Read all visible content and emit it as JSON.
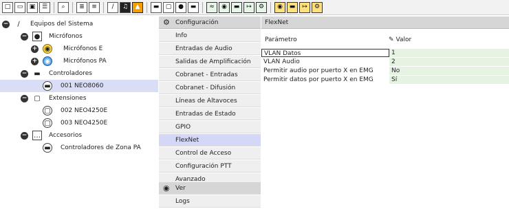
{
  "toolbar": {
    "buttons": [
      {
        "icon": "new-document-icon",
        "glyph": "□"
      },
      {
        "icon": "new-window-icon",
        "glyph": "▭"
      },
      {
        "icon": "save-icon",
        "glyph": "▣"
      },
      {
        "icon": "print-icon",
        "glyph": "☰"
      },
      {
        "icon": "search-icon",
        "glyph": "⌕"
      },
      {
        "icon": "properties-icon",
        "glyph": "≣"
      },
      {
        "icon": "list-icon",
        "glyph": "≡"
      },
      {
        "icon": "pencil-icon",
        "glyph": "∕"
      },
      {
        "icon": "music-icon",
        "glyph": "♫"
      },
      {
        "icon": "flag-icon",
        "glyph": "▲"
      },
      {
        "icon": "monitor-icon",
        "glyph": "▬"
      },
      {
        "icon": "extension-icon",
        "glyph": "▢"
      },
      {
        "icon": "microphone-icon",
        "glyph": "●"
      },
      {
        "icon": "controller-icon",
        "glyph": "▬"
      },
      {
        "icon": "wave-icon",
        "glyph": "≈"
      },
      {
        "icon": "mic-blue-icon",
        "glyph": "◉"
      },
      {
        "icon": "chat-icon",
        "glyph": "▬"
      },
      {
        "icon": "export-icon",
        "glyph": "↦"
      },
      {
        "icon": "settings-icon",
        "glyph": "⚙"
      },
      {
        "icon": "yellow-mic-icon",
        "glyph": "◉"
      },
      {
        "icon": "speaker-icon",
        "glyph": "▬"
      },
      {
        "icon": "forward-icon",
        "glyph": "↦"
      },
      {
        "icon": "gear-small-icon",
        "glyph": "⚙"
      }
    ]
  },
  "tree": [
    {
      "label": "Equipos del Sistema",
      "icon": "pencil-icon",
      "glyph": "∕",
      "expander": "−"
    },
    {
      "label": "Micrófonos",
      "icon": "microphone-icon",
      "glyph": "●",
      "expander": "−"
    },
    {
      "label": "Micrófonos E",
      "icon": "yellow-mic-icon",
      "glyph": "◉",
      "expander": "+"
    },
    {
      "label": "Micrófonos PA",
      "icon": "blue-mic-icon",
      "glyph": "◉",
      "expander": "+"
    },
    {
      "label": "Controladores",
      "icon": "monitor-icon",
      "glyph": "▬",
      "expander": "−"
    },
    {
      "label": "001 NEO8060",
      "icon": "device-icon",
      "glyph": "▬"
    },
    {
      "label": "Extensiones",
      "icon": "extension-icon",
      "glyph": "▢",
      "expander": "−"
    },
    {
      "label": "002 NEO4250E",
      "icon": "extension-device-icon",
      "glyph": "▢"
    },
    {
      "label": "003 NEO4250E",
      "icon": "extension-device-icon",
      "glyph": "▢"
    },
    {
      "label": "Accesorios",
      "icon": "more-icon",
      "glyph": "…",
      "expander": "−"
    },
    {
      "label": "Controladores de Zona PA",
      "icon": "zone-controller-icon",
      "glyph": "▬"
    }
  ],
  "menu": {
    "header": "Configuración",
    "items": [
      "Info",
      "Entradas de Audio",
      "Salidas de Amplificación",
      "Cobranet - Entradas",
      "Cobranet - Difusión",
      "Líneas de Altavoces",
      "Entradas de Estado",
      "GPIO",
      "FlexNet",
      "Control de Acceso",
      "Configuración PTT",
      "Avanzado"
    ],
    "active": "FlexNet",
    "ver": "Ver",
    "logs": "Logs"
  },
  "panel": {
    "title": "FlexNet",
    "col_param": "Parámetro",
    "col_value": "Valor",
    "rows": [
      {
        "param": "VLAN Datos",
        "value": "1"
      },
      {
        "param": "VLAN Audio",
        "value": "2"
      },
      {
        "param": "Permitir audio por puerto X en EMG",
        "value": "No"
      },
      {
        "param": "Permitir datos por puerto X en EMG",
        "value": "Sí"
      }
    ]
  },
  "colors": {
    "selected_row": "#d9ddf6",
    "active_menu": "#d4d7f5",
    "value_cell": "#e6f2e2",
    "header_bg": "#d6d6d6"
  }
}
